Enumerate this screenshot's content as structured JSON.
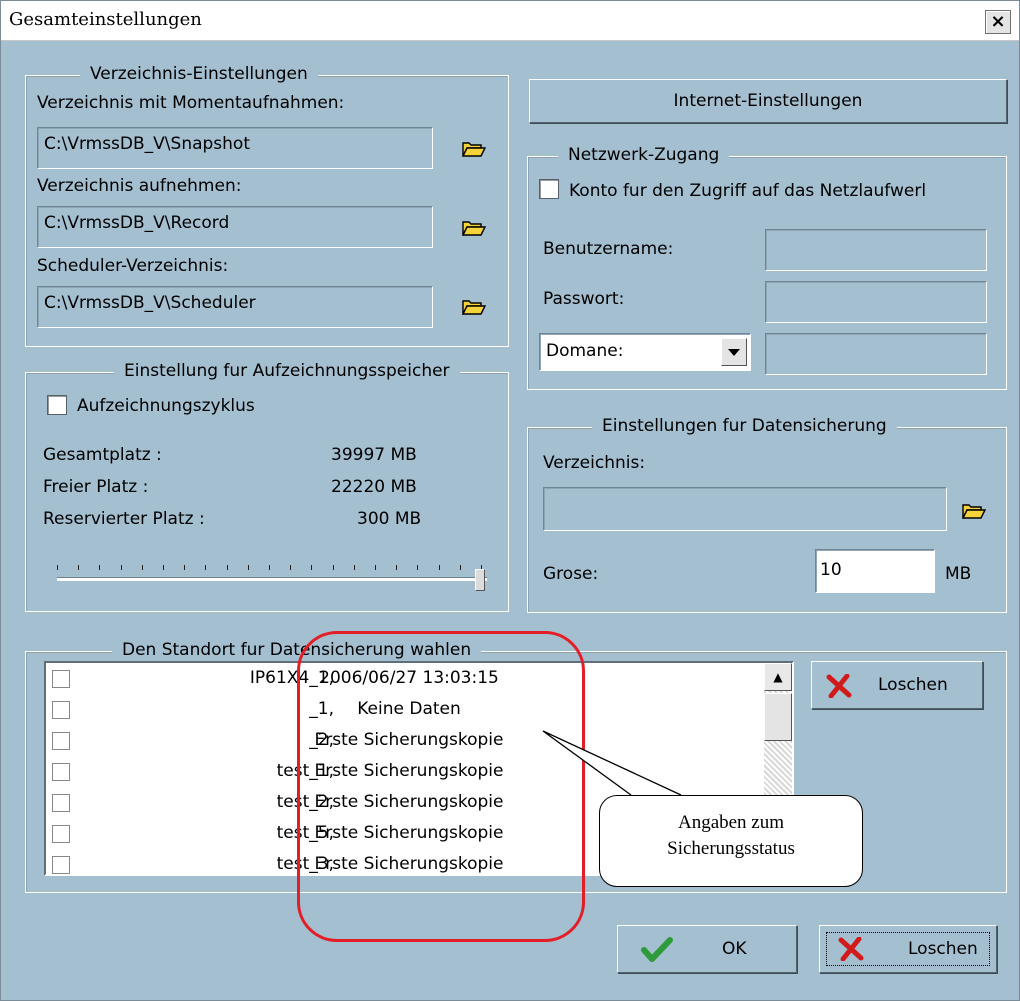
{
  "window": {
    "title": "Gesamteinstellungen",
    "close_glyph": "×"
  },
  "directory": {
    "group_title": "Verzeichnis-Einstellungen",
    "snapshot_label": "Verzeichnis mit Momentaufnahmen:",
    "snapshot_path": "C:\\VrmssDB_V\\Snapshot",
    "record_label": "Verzeichnis aufnehmen:",
    "record_path": "C:\\VrmssDB_V\\Record",
    "scheduler_label": "Scheduler-Verzeichnis:",
    "scheduler_path": "C:\\VrmssDB_V\\Scheduler"
  },
  "storage": {
    "group_title": "Einstellung fur Aufzeichnungsspeicher",
    "cycle_label": "Aufzeichnungszyklus",
    "total_label": "Gesamtplatz :",
    "total_value": "39997 MB",
    "free_label": "Freier Platz :",
    "free_value": "22220 MB",
    "reserved_label": "Reservierter Platz :",
    "reserved_value": "300 MB",
    "slider_level": 1.0
  },
  "internet_button": "Internet-Einstellungen",
  "network": {
    "group_title": "Netzwerk-Zugang",
    "account_label": "Konto fur den Zugriff auf das Netzlaufwerl",
    "username_label": "Benutzername:",
    "password_label": "Passwort:",
    "domain_option": "Domane:"
  },
  "backup": {
    "group_title": "Einstellungen fur Datensicherung",
    "dir_label": "Verzeichnis:",
    "size_label": "Grose:",
    "size_value": "10",
    "size_unit": "MB"
  },
  "location": {
    "group_title": "Den Standort fur Datensicherung wahlen",
    "delete_label": "Loschen",
    "rows": [
      {
        "name": "IP61X4_1,",
        "status": "2006/06/27 13:03:15"
      },
      {
        "name": "_1,",
        "status": "Keine Daten"
      },
      {
        "name": "_2,",
        "status": "Erste Sicherungskopie"
      },
      {
        "name": "test_1,",
        "status": "Erste Sicherungskopie"
      },
      {
        "name": "test_2,",
        "status": "Erste Sicherungskopie"
      },
      {
        "name": "test_5,",
        "status": "Erste Sicherungskopie"
      },
      {
        "name": "test_3,",
        "status": "Erste Sicherungskopie"
      }
    ]
  },
  "callout": {
    "line1": "Angaben zum",
    "line2": "Sicherungsstatus"
  },
  "footer": {
    "ok_label": "OK",
    "delete_label": "Loschen"
  },
  "colors": {
    "background": "#a4bfd0",
    "accent_red": "#e41e26",
    "check_green": "#2e9b3a",
    "folder_yellow": "#f3d23a"
  },
  "icons": [
    "folder-icon",
    "delete-x-icon",
    "check-icon",
    "dropdown-arrow-icon",
    "scroll-up-icon"
  ]
}
